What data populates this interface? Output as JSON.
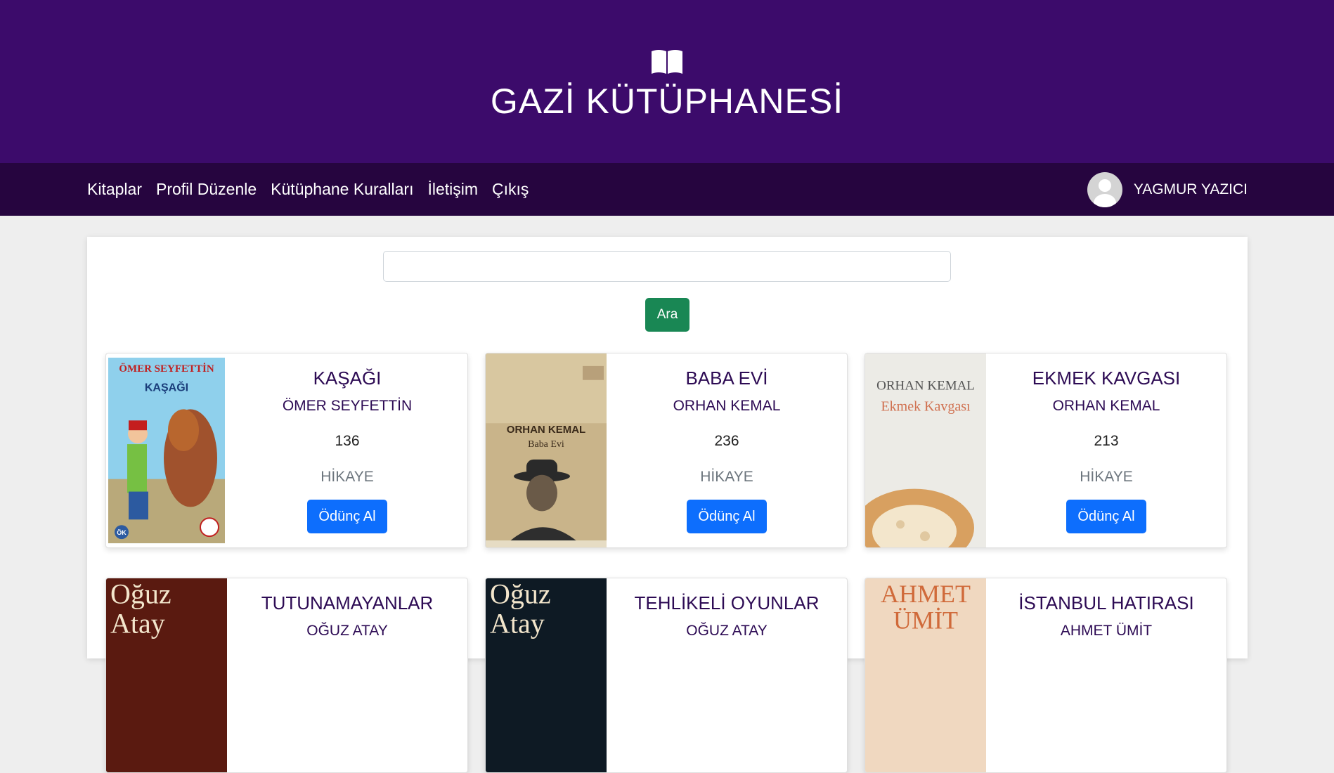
{
  "header": {
    "title": "GAZİ KÜTÜPHANESİ",
    "icon": "open-book-icon"
  },
  "nav": {
    "links": [
      "Kitaplar",
      "Profil Düzenle",
      "Kütüphane Kuralları",
      "İletişim",
      "Çıkış"
    ],
    "user_name": "YAGMUR YAZICI",
    "user_icon": "avatar-icon"
  },
  "search": {
    "value": "",
    "button_label": "Ara"
  },
  "books": [
    {
      "title": "KAŞAĞI",
      "author": "ÖMER SEYFETTİN",
      "pages": "136",
      "genre": "HİKAYE",
      "button": "Ödünç Al",
      "cover_text_top": "ÖMER SEYFETTİN",
      "cover_text_bottom": "KAŞAĞI",
      "cover_badge": "ÖK"
    },
    {
      "title": "BABA EVİ",
      "author": "ORHAN KEMAL",
      "pages": "236",
      "genre": "HİKAYE",
      "button": "Ödünç Al",
      "cover_text_top": "ORHAN KEMAL",
      "cover_text_bottom": "Baba Evi"
    },
    {
      "title": "EKMEK KAVGASI",
      "author": "ORHAN KEMAL",
      "pages": "213",
      "genre": "HİKAYE",
      "button": "Ödünç Al",
      "cover_text_top": "ORHAN KEMAL",
      "cover_text_bottom": "Ekmek Kavgası"
    },
    {
      "title": "TUTUNAMAYANLAR",
      "author": "OĞUZ ATAY",
      "cover_text_top": "Oğuz",
      "cover_text_bottom": "Atay"
    },
    {
      "title": "TEHLİKELİ OYUNLAR",
      "author": "OĞUZ ATAY",
      "cover_text_top": "Oğuz",
      "cover_text_bottom": "Atay"
    },
    {
      "title": "İSTANBUL HATIRASI",
      "author": "AHMET ÜMİT",
      "cover_text_top": "AHMET",
      "cover_text_bottom": "ÜMİT"
    }
  ],
  "colors": {
    "header_bg": "#3c0b6b",
    "nav_bg": "#26053f",
    "search_button": "#198754",
    "borrow_button": "#0d6efd"
  }
}
